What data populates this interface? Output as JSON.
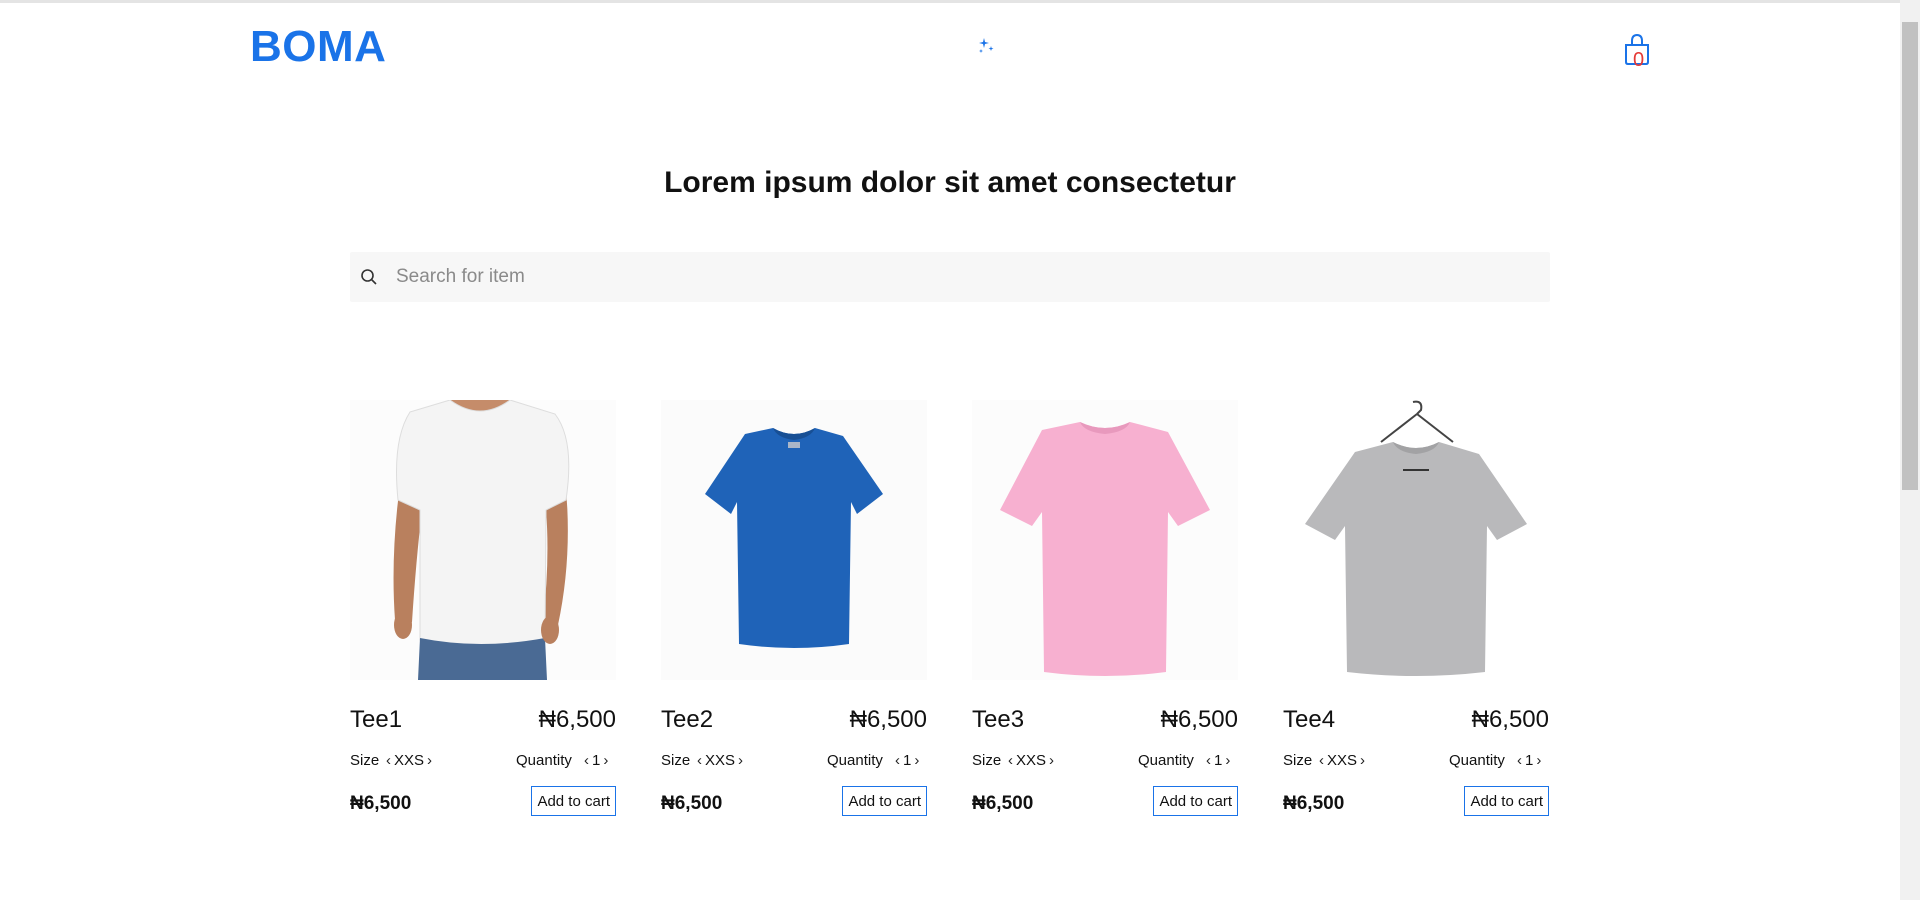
{
  "header": {
    "logo": "BOMA",
    "cart_count": "0"
  },
  "main": {
    "headline": "Lorem ipsum dolor sit amet consectetur",
    "search_placeholder": "Search for item"
  },
  "colors": {
    "brand": "#1a73e8",
    "cart_badge": "#e53935"
  },
  "products": [
    {
      "name": "Tee1",
      "price": "₦6,500",
      "size_label": "Size",
      "size": "XXS",
      "qty_label": "Quantity",
      "qty": "1",
      "total": "₦6,500",
      "add_label": "Add to cart",
      "image": "white-tshirt-on-model"
    },
    {
      "name": "Tee2",
      "price": "₦6,500",
      "size_label": "Size",
      "size": "XXS",
      "qty_label": "Quantity",
      "qty": "1",
      "total": "₦6,500",
      "add_label": "Add to cart",
      "image": "blue-tshirt"
    },
    {
      "name": "Tee3",
      "price": "₦6,500",
      "size_label": "Size",
      "size": "XXS",
      "qty_label": "Quantity",
      "qty": "1",
      "total": "₦6,500",
      "add_label": "Add to cart",
      "image": "pink-tshirt"
    },
    {
      "name": "Tee4",
      "price": "₦6,500",
      "size_label": "Size",
      "size": "XXS",
      "qty_label": "Quantity",
      "qty": "1",
      "total": "₦6,500",
      "add_label": "Add to cart",
      "image": "grey-tshirt-on-hanger"
    }
  ]
}
